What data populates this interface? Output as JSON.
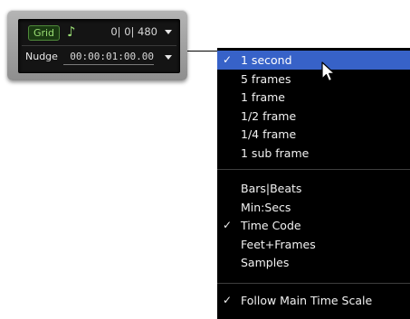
{
  "panel": {
    "grid_label": "Grid",
    "note_symbol": "♪",
    "grid_value": "0| 0| 480",
    "nudge_label": "Nudge",
    "nudge_value": "00:00:01:00.00"
  },
  "menu": {
    "resolution_items": [
      {
        "label": "1 second",
        "checked": true,
        "highlighted": true
      },
      {
        "label": "5 frames",
        "checked": false
      },
      {
        "label": "1 frame",
        "checked": false
      },
      {
        "label": "1/2 frame",
        "checked": false
      },
      {
        "label": "1/4 frame",
        "checked": false
      },
      {
        "label": "1 sub frame",
        "checked": false
      }
    ],
    "format_items": [
      {
        "label": "Bars|Beats",
        "checked": false
      },
      {
        "label": "Min:Secs",
        "checked": false
      },
      {
        "label": "Time Code",
        "checked": true
      },
      {
        "label": "Feet+Frames",
        "checked": false
      },
      {
        "label": "Samples",
        "checked": false
      }
    ],
    "follow_item": {
      "label": "Follow Main Time Scale",
      "checked": true
    },
    "check_glyph": "✓"
  },
  "colors": {
    "highlight": "#3762c8",
    "grid_green": "#9ade74"
  }
}
